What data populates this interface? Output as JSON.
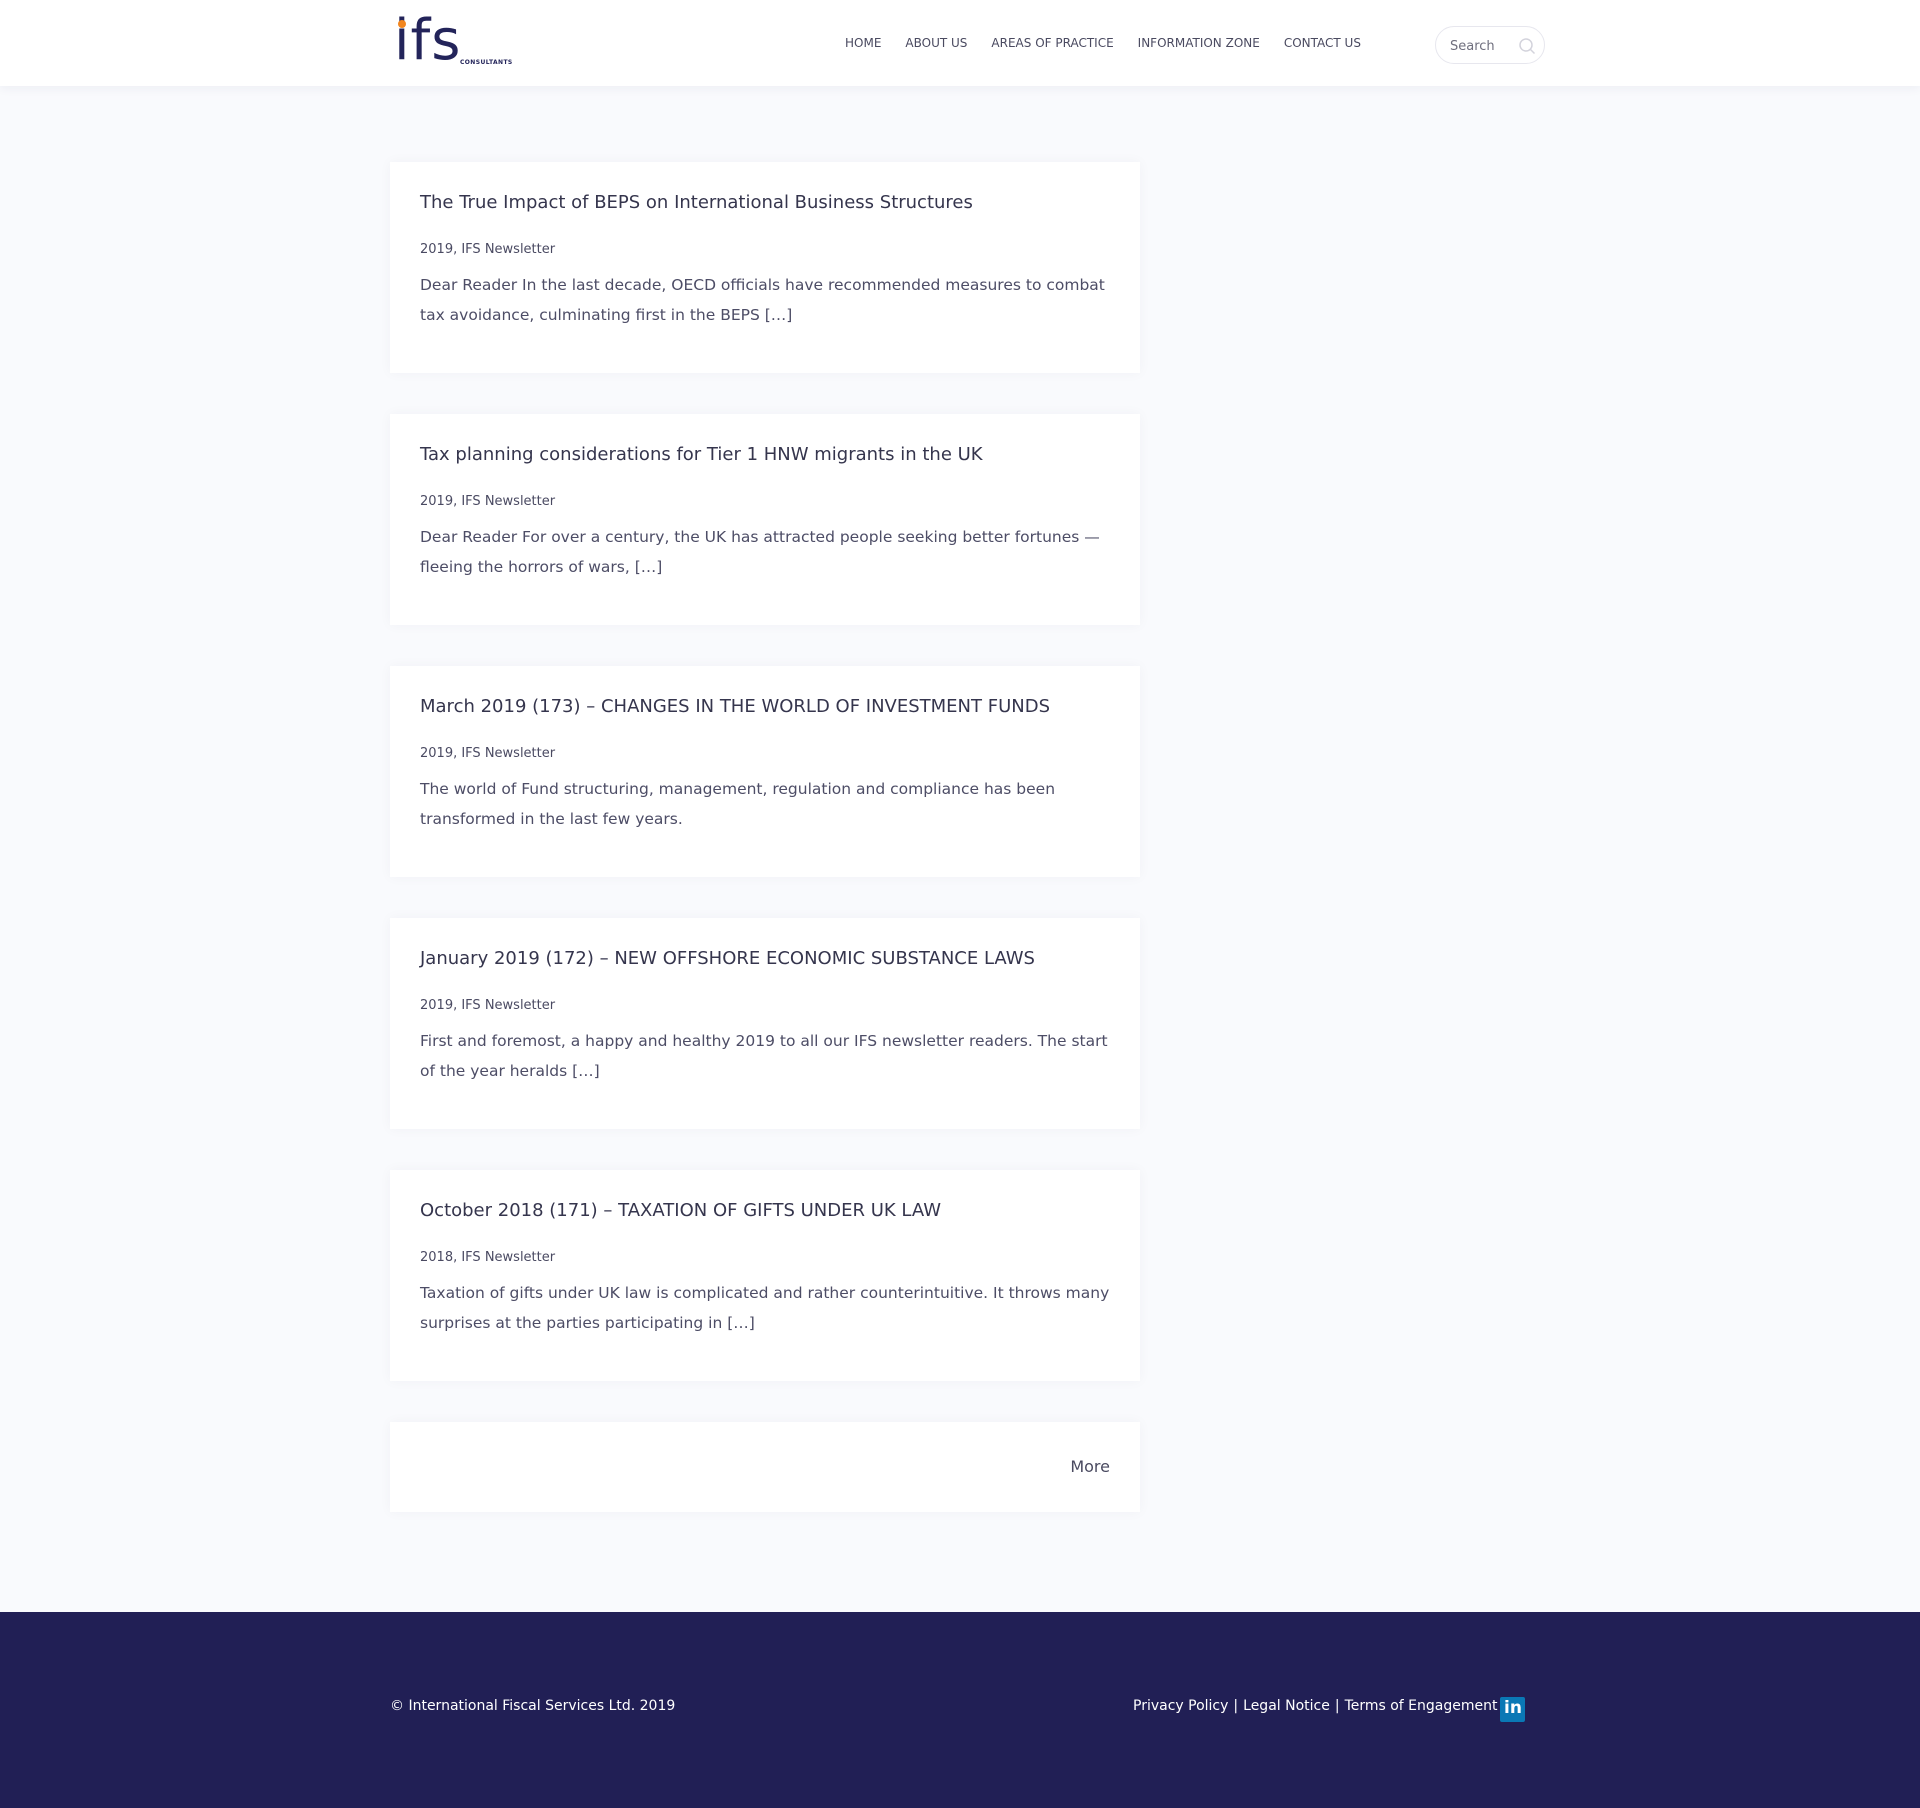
{
  "header": {
    "logo_text": "ifs",
    "logo_subtext": "CONSULTANTS",
    "nav": [
      "HOME",
      "ABOUT US",
      "AREAS OF PRACTICE",
      "INFORMATION ZONE",
      "CONTACT US"
    ],
    "search": {
      "placeholder": "Search"
    }
  },
  "posts": [
    {
      "title": "The True Impact of BEPS on International Business Structures",
      "meta": "2019, IFS Newsletter",
      "excerpt": "Dear Reader In the last decade, OECD officials have recommended measures to combat tax avoidance, culminating first in the BEPS […]"
    },
    {
      "title": "Tax planning considerations for Tier 1 HNW migrants in the UK",
      "meta": "2019, IFS Newsletter",
      "excerpt": "Dear Reader For over a century, the UK has attracted people seeking better fortunes — fleeing the horrors of wars, […]"
    },
    {
      "title": "March 2019 (173) – CHANGES IN THE WORLD OF INVESTMENT FUNDS",
      "meta": "2019, IFS Newsletter",
      "excerpt": "The world of Fund structuring, management, regulation and compliance has been transformed in the last few years."
    },
    {
      "title": "January 2019 (172) – NEW OFFSHORE ECONOMIC SUBSTANCE LAWS",
      "meta": "2019, IFS Newsletter",
      "excerpt": "First and foremost, a happy and healthy 2019 to all our IFS newsletter readers. The start of the year heralds […]"
    },
    {
      "title": "October 2018 (171) – TAXATION OF GIFTS UNDER UK LAW",
      "meta": "2018, IFS Newsletter",
      "excerpt": "Taxation of gifts under UK law is complicated and rather counterintuitive. It throws many surprises at the parties participating in […]"
    }
  ],
  "more_label": "More",
  "footer": {
    "copyright": "© International Fiscal Services Ltd. 2019",
    "links": [
      "Privacy Policy",
      "Legal Notice",
      "Terms of Engagement"
    ],
    "separator": "|",
    "social_icon": "linkedin-icon",
    "social_text": "in"
  },
  "colors": {
    "brand_navy": "#211f55",
    "logo_accent": "#f2861f",
    "page_bg": "#f9fafd",
    "linkedin": "#0a78b5"
  }
}
